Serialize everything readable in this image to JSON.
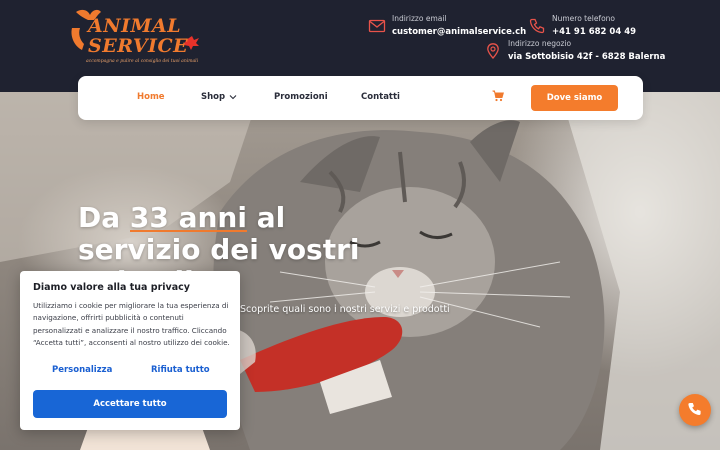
{
  "brand": {
    "logo_line1": "ANIMAL",
    "logo_line2": "SERVICE",
    "tagline": "accompagna e pulire al consiglio dei tuoi animali",
    "accent_color": "#f07a2e",
    "dark_color": "#1f2230"
  },
  "contacts": {
    "email": {
      "label": "Indirizzo email",
      "value": "customer@animalservice.ch",
      "icon": "envelope-icon"
    },
    "phone": {
      "label": "Numero telefono",
      "value": "+41 91 682 04 49",
      "icon": "phone-icon"
    },
    "shop": {
      "label": "Indirizzo negozio",
      "value": "via Sottobisio 42f - 6828 Balerna",
      "icon": "map-pin-icon"
    }
  },
  "nav": {
    "items": [
      {
        "label": "Home",
        "active": true
      },
      {
        "label": "Shop",
        "has_dropdown": true
      },
      {
        "label": "Promozioni"
      },
      {
        "label": "Contatti"
      }
    ],
    "cart_icon": "shopping-cart-icon",
    "cta_label": "Dove siamo"
  },
  "hero": {
    "title_part1": "Da ",
    "title_highlight": "33 anni",
    "title_part2": " al servizio dei vostri animali",
    "subtitle": "Scoprite quali sono i nostri servizi e prodotti"
  },
  "cookie": {
    "title": "Diamo valore alla tua privacy",
    "text": "Utilizziamo i cookie per migliorare la tua esperienza di navigazione, offrirti pubblicità o contenuti personalizzati e analizzare il nostro traffico. Cliccando “Accetta tutti”, acconsenti al nostro utilizzo dei cookie.",
    "customize_label": "Personalizza",
    "reject_label": "Rifiuta tutto",
    "accept_label": "Accettare tutto",
    "primary_color": "#1866d6"
  },
  "floating": {
    "icon": "phone-icon"
  }
}
